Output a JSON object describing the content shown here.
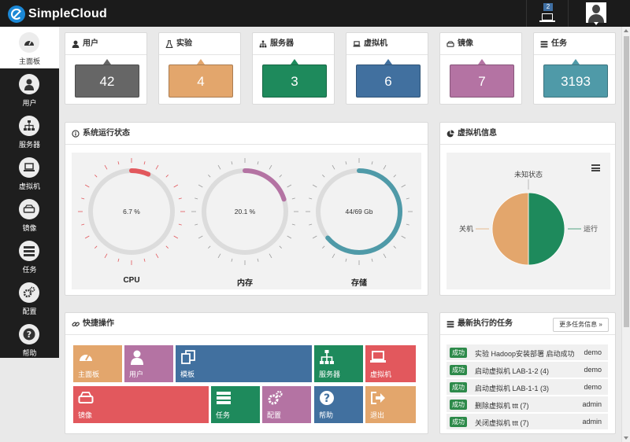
{
  "header": {
    "app_name": "SimpleCloud",
    "notification_count": "2"
  },
  "sidebar": {
    "items": [
      {
        "label": "主面板",
        "icon": "dashboard-icon"
      },
      {
        "label": "用户",
        "icon": "user-icon"
      },
      {
        "label": "服务器",
        "icon": "sitemap-icon"
      },
      {
        "label": "虚拟机",
        "icon": "laptop-icon"
      },
      {
        "label": "镜像",
        "icon": "hdd-icon"
      },
      {
        "label": "任务",
        "icon": "tasks-icon"
      },
      {
        "label": "配置",
        "icon": "cogs-icon"
      },
      {
        "label": "帮助",
        "icon": "question-icon"
      }
    ]
  },
  "stats": [
    {
      "label": "用户",
      "value": "42",
      "color": "#666666"
    },
    {
      "label": "实验",
      "value": "4",
      "color": "#e3a66c"
    },
    {
      "label": "服务器",
      "value": "3",
      "color": "#1e8a5c"
    },
    {
      "label": "虚拟机",
      "value": "6",
      "color": "#41709f"
    },
    {
      "label": "镜像",
      "value": "7",
      "color": "#b473a3"
    },
    {
      "label": "任务",
      "value": "3193",
      "color": "#4f9aa8"
    }
  ],
  "system_status": {
    "title": "系统运行状态",
    "gauges": [
      {
        "label": "CPU",
        "text": "6.7 %",
        "fraction": 0.067,
        "color": "#e2585d"
      },
      {
        "label": "内存",
        "text": "20.1 %",
        "fraction": 0.201,
        "color": "#b473a3"
      },
      {
        "label": "存储",
        "text": "44/69 Gb",
        "fraction": 0.638,
        "color": "#4f9aa8"
      }
    ]
  },
  "vm_info": {
    "title": "虚拟机信息",
    "chart_data": {
      "type": "pie",
      "title": "",
      "slices": [
        {
          "label": "运行",
          "value": 50,
          "color": "#1e8a5c"
        },
        {
          "label": "关机",
          "value": 50,
          "color": "#e3a66c"
        },
        {
          "label": "未知状态",
          "value": 0,
          "color": "#aaaaaa"
        }
      ]
    }
  },
  "quick_actions": {
    "title": "快捷操作",
    "tiles": [
      {
        "label": "主面板",
        "color": "#e3a66c",
        "icon": "dashboard-icon"
      },
      {
        "label": "用户",
        "color": "#b473a3",
        "icon": "user-icon"
      },
      {
        "label": "模板",
        "color": "#41709f",
        "icon": "copy-icon"
      },
      {
        "label": "服务器",
        "color": "#1e8a5c",
        "icon": "sitemap-icon"
      },
      {
        "label": "虚拟机",
        "color": "#e2585d",
        "icon": "laptop-icon"
      },
      {
        "label": "镜像",
        "color": "#e2585d",
        "icon": "hdd-icon"
      },
      {
        "label": "任务",
        "color": "#1e8a5c",
        "icon": "tasks-icon"
      },
      {
        "label": "配置",
        "color": "#b473a3",
        "icon": "cogs-icon"
      },
      {
        "label": "帮助",
        "color": "#41709f",
        "icon": "question-icon"
      },
      {
        "label": "退出",
        "color": "#e3a66c",
        "icon": "sign-out-icon"
      }
    ]
  },
  "tasks": {
    "title": "最新执行的任务",
    "more_label": "更多任务信息 »",
    "rows": [
      {
        "status": "成功",
        "text": "实验 Hadoop安装部署 启动成功",
        "user": "demo"
      },
      {
        "status": "成功",
        "text": "启动虚拟机 LAB-1-2 (4)",
        "user": "demo"
      },
      {
        "status": "成功",
        "text": "启动虚拟机 LAB-1-1 (3)",
        "user": "demo"
      },
      {
        "status": "成功",
        "text": "删除虚拟机 ttt (7)",
        "user": "admin"
      },
      {
        "status": "成功",
        "text": "关闭虚拟机 ttt (7)",
        "user": "admin"
      }
    ]
  }
}
